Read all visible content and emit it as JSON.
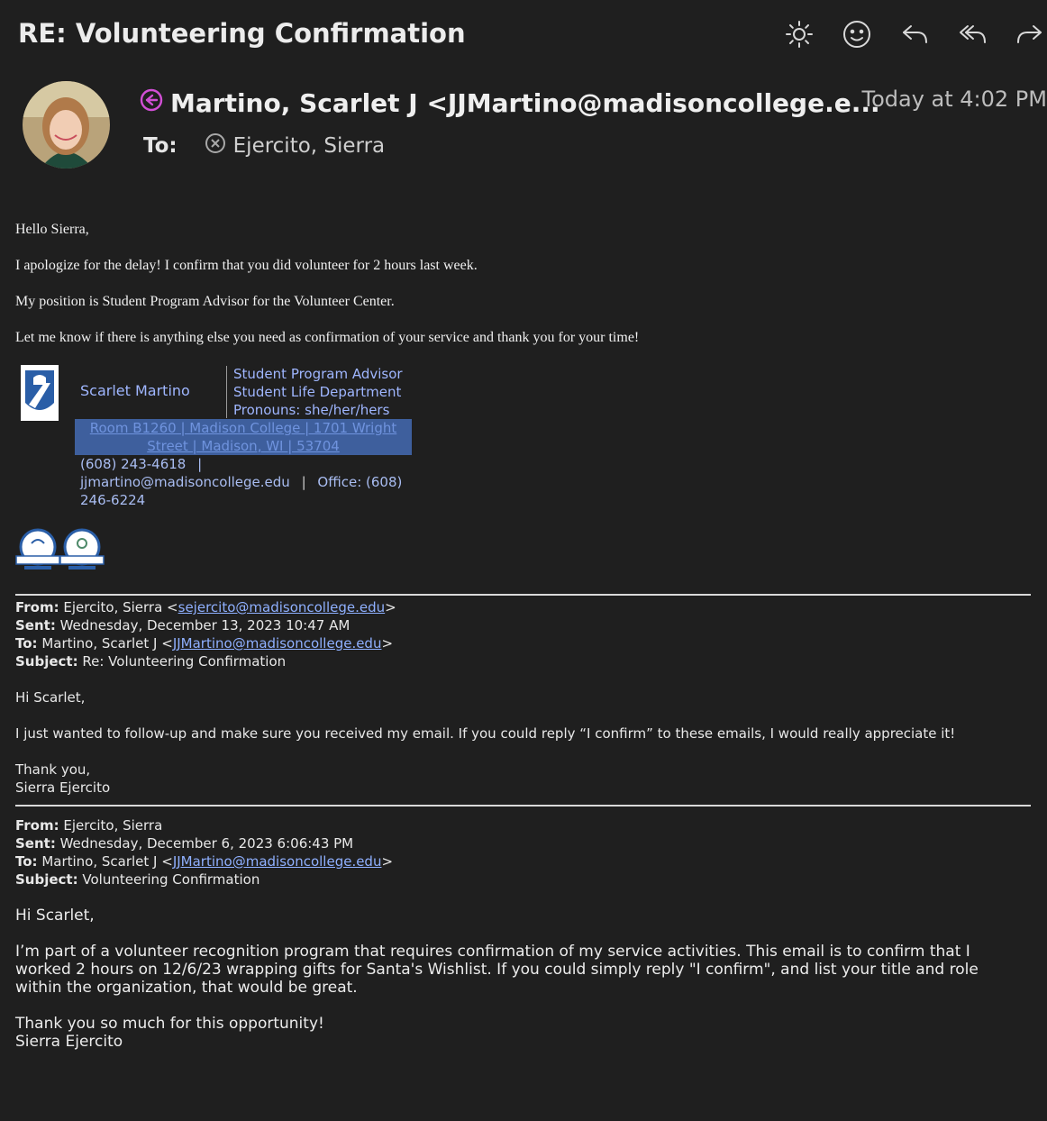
{
  "header": {
    "subject": "RE: Volunteering Confirmation",
    "toolbar_icons": [
      "sun-icon",
      "smiley-icon",
      "reply-icon",
      "reply-all-icon",
      "forward-icon"
    ]
  },
  "message": {
    "from": "Martino, Scarlet J <JJMartino@madisoncollege.e...",
    "date": "Today at 4:02 PM",
    "to_label": "To:",
    "to": "Ejercito, Sierra"
  },
  "body": {
    "greeting": "Hello Sierra,",
    "p1": "I apologize for the delay! I confirm that you did volunteer for 2 hours last week.",
    "p2": "My position is Student Program Advisor for the Volunteer Center.",
    "p3": "Let me know if there is anything else you need as confirmation of your service and thank you for your time!"
  },
  "signature": {
    "name": "Scarlet Martino",
    "title": "Student Program Advisor",
    "department": "Student Life Department",
    "pronouns": "Pronouns: she/her/hers",
    "address_line1": "Room B1260  |  Madison College  |  1701 Wright",
    "address_line2": "Street  |  Madison, WI  |  53704",
    "phone": "(608) 243-4618",
    "phone_sep": "|",
    "email": "jjmartino@madisoncollege.edu",
    "office_sep": "|",
    "office": "Office: (608)",
    "office_cont": "246-6224"
  },
  "quoted1": {
    "from_label": "From:",
    "from_name": " Ejercito, Sierra <",
    "from_email": "sejercito@madisoncollege.edu",
    "from_end": ">",
    "sent_label": "Sent:",
    "sent": " Wednesday, December 13, 2023 10:47 AM",
    "to_label": "To:",
    "to_name": " Martino, Scarlet J <",
    "to_email": "JJMartino@madisoncollege.edu",
    "to_end": ">",
    "subject_label": "Subject:",
    "subject": " Re: Volunteering Confirmation",
    "greeting": "Hi Scarlet,",
    "p1": "I just wanted to follow-up and make sure you received my email. If you could reply “I confirm” to these emails, I would really appreciate it!",
    "thanks": "Thank you,",
    "sign": "Sierra Ejercito"
  },
  "quoted2": {
    "from_label": "From:",
    "from_name": " Ejercito, Sierra",
    "sent_label": "Sent:",
    "sent": " Wednesday, December 6, 2023 6:06:43 PM",
    "to_label": "To:",
    "to_name": " Martino, Scarlet J <",
    "to_email": "JJMartino@madisoncollege.edu",
    "to_end": ">",
    "subject_label": "Subject:",
    "subject": " Volunteering Confirmation",
    "greeting": "Hi Scarlet,",
    "l1": "I’m part of a volunteer recognition program that requires confirmation of my service activities. This email is to confirm that I",
    "l2": "worked 2 hours on 12/6/23 wrapping gifts for Santa's Wishlist. If you could simply reply \"I confirm\", and list your title and role",
    "l3": "within the organization, that would be great.",
    "thanks": "Thank you so much for this opportunity!",
    "sign": "Sierra Ejercito"
  }
}
